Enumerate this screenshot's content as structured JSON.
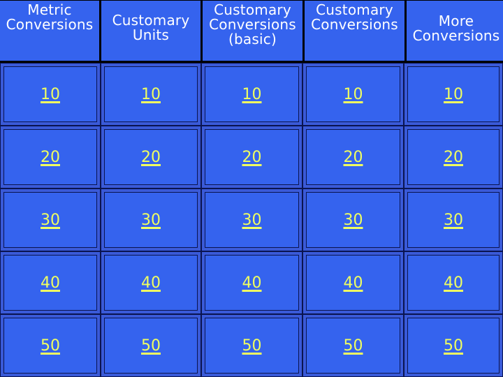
{
  "board": {
    "categories": [
      {
        "label": "Metric\nConversions"
      },
      {
        "label": "Customary\nUnits"
      },
      {
        "label": "Customary\nConversions\n(basic)"
      },
      {
        "label": "Customary\nConversions"
      },
      {
        "label": "More\nConversions"
      }
    ],
    "point_values": [
      "10",
      "20",
      "30",
      "40",
      "50"
    ],
    "rows": [
      [
        "10",
        "10",
        "10",
        "10",
        "10"
      ],
      [
        "20",
        "20",
        "20",
        "20",
        "20"
      ],
      [
        "30",
        "30",
        "30",
        "30",
        "30"
      ],
      [
        "40",
        "40",
        "40",
        "40",
        "40"
      ],
      [
        "50",
        "50",
        "50",
        "50",
        "50"
      ]
    ]
  },
  "colors": {
    "background": "#000000",
    "tile": "#3563ee",
    "tile_bevel": "#3a5ad8",
    "header_text": "#ffffff",
    "value_text": "#f0ff60"
  }
}
